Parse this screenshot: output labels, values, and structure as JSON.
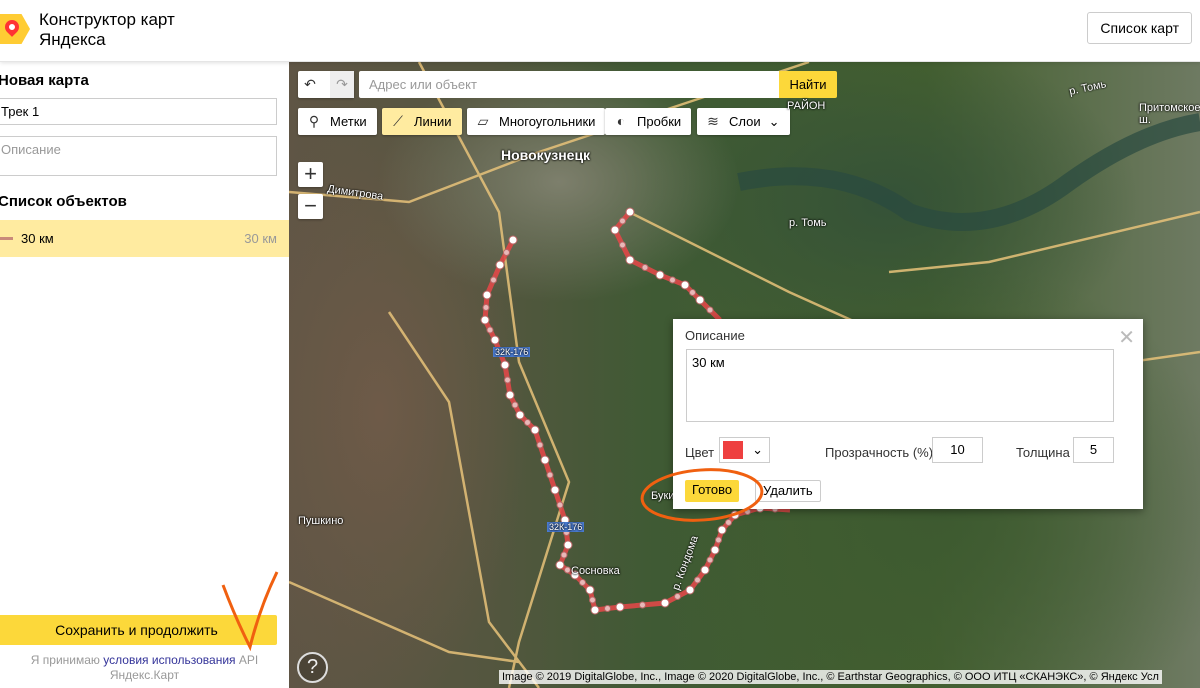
{
  "header": {
    "title_line1": "Конструктор карт",
    "title_line2": "Яндекса",
    "maps_list_button": "Список карт"
  },
  "sidebar": {
    "map_heading": "Новая карта",
    "name_value": "Трек 1",
    "description_placeholder": "Описание",
    "objects_heading": "Список объектов",
    "objects": [
      {
        "name": "30 км",
        "length": "30 км",
        "color": "#c98a7a"
      }
    ],
    "save_button": "Сохранить и продолжить",
    "terms_prefix": "Я принимаю",
    "terms_link": "условия использования",
    "terms_suffix": "API Яндекс.Карт"
  },
  "map": {
    "search_placeholder": "Адрес или объект",
    "find_button": "Найти",
    "tools": [
      {
        "label": "Метки",
        "icon": "placemark-icon"
      },
      {
        "label": "Линии",
        "icon": "line-icon",
        "active": true
      },
      {
        "label": "Многоугольники",
        "icon": "polygon-icon"
      },
      {
        "label": "Пробки",
        "icon": "traffic-icon"
      },
      {
        "label": "Слои",
        "icon": "layers-icon"
      }
    ],
    "labels": {
      "city": "Новокузнецк",
      "street": "Димитрова",
      "village1": "Пушкино",
      "village2": "Сосновка",
      "village3": "Буки",
      "river": "р. Томь",
      "river2": "р. Томь",
      "highway": "Притомское ш.",
      "district": "РАЙОН",
      "road1": "32К-176",
      "road2": "32К-176",
      "river3": "р. Кондома"
    },
    "help": "?",
    "copyright": "Image © 2019 DigitalGlobe, Inc., Image © 2020 DigitalGlobe, Inc., © Earthstar Geographics, © ООО ИТЦ «СКАНЭКС», © Яндекс Усл"
  },
  "popup": {
    "description_label": "Описание",
    "description_value": "30 км",
    "color_label": "Цвет",
    "color_value": "#ee4040",
    "opacity_label": "Прозрачность (%)",
    "opacity_value": "10",
    "width_label": "Толщина",
    "width_value": "5",
    "done_button": "Готово",
    "delete_button": "Удалить"
  },
  "colors": {
    "accent": "#fcd83a",
    "line": "#e04848",
    "annotation": "#f06010"
  }
}
